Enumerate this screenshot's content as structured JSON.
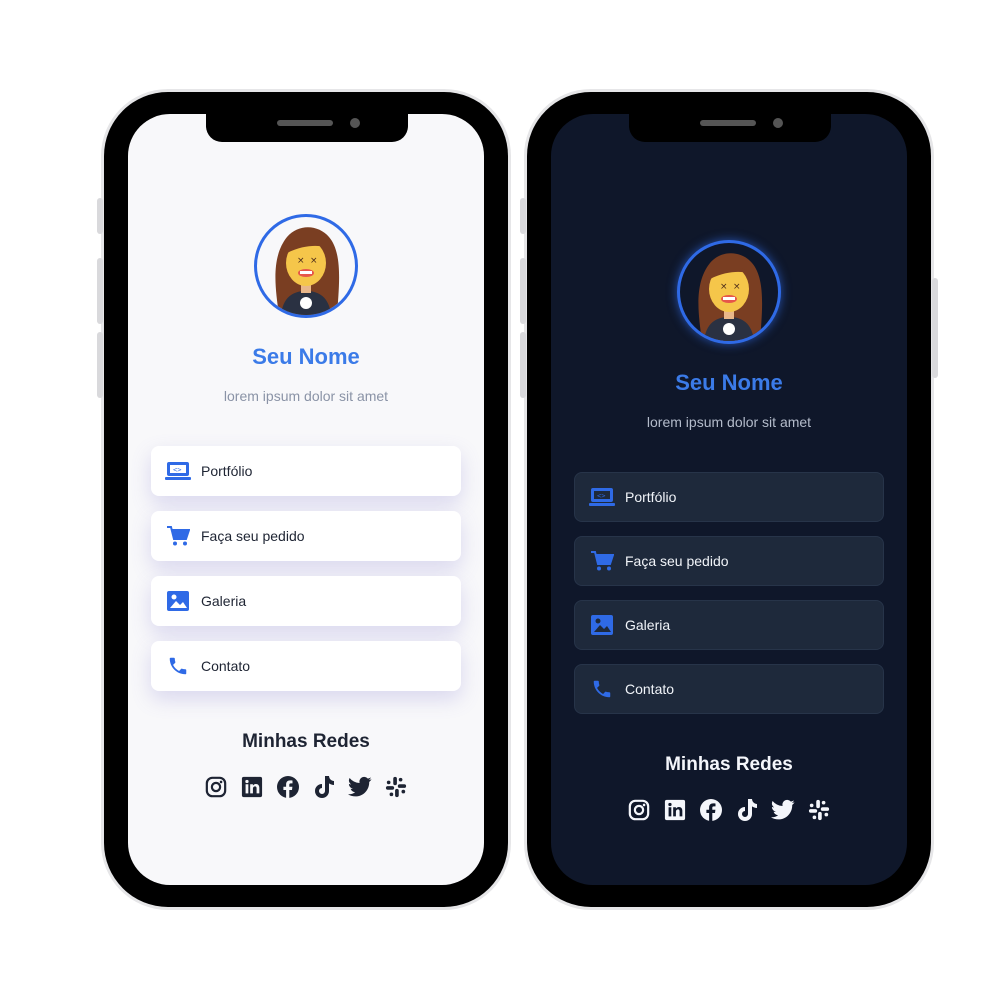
{
  "profile": {
    "name": "Seu Nome",
    "subtitle": "lorem ipsum dolor sit amet"
  },
  "links": [
    {
      "label": "Portfólio",
      "icon": "laptop-code-icon"
    },
    {
      "label": "Faça seu pedido",
      "icon": "shopping-cart-icon"
    },
    {
      "label": "Galeria",
      "icon": "image-icon"
    },
    {
      "label": "Contato",
      "icon": "phone-icon"
    }
  ],
  "networks": {
    "title": "Minhas Redes",
    "icons": [
      "instagram-icon",
      "linkedin-icon",
      "facebook-icon",
      "tiktok-icon",
      "twitter-icon",
      "slack-icon"
    ]
  },
  "colors": {
    "accent": "#2f6ae6",
    "name": "#3b7be8",
    "light_bg": "#f8f8fa",
    "dark_bg": "#0f172a",
    "dark_card": "#1e293b"
  }
}
